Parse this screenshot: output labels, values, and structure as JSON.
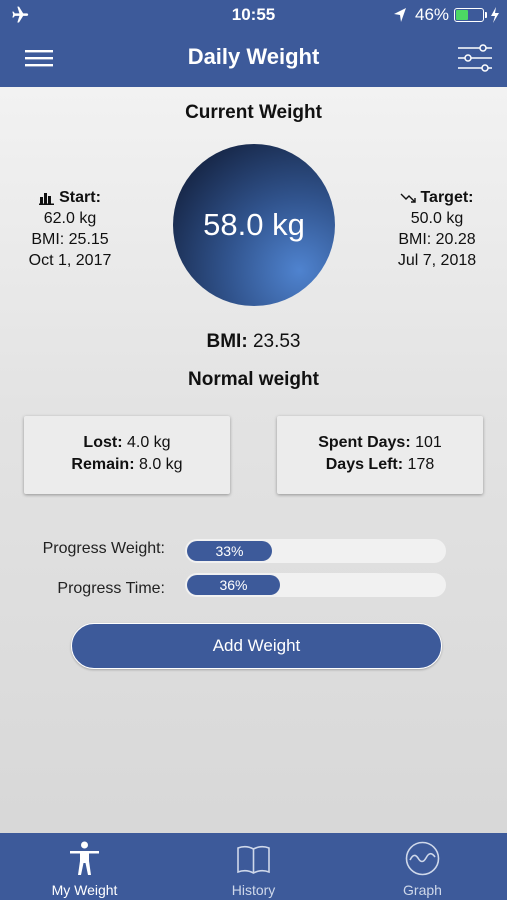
{
  "status_bar": {
    "time": "10:55",
    "battery_percent": "46%",
    "battery_level": 0.46
  },
  "nav": {
    "title": "Daily Weight"
  },
  "current": {
    "title": "Current Weight",
    "weight": "58.0 kg"
  },
  "start": {
    "label": "Start:",
    "weight": "62.0 kg",
    "bmi": "BMI: 25.15",
    "date": "Oct 1, 2017"
  },
  "target": {
    "label": "Target:",
    "weight": "50.0 kg",
    "bmi": "BMI: 20.28",
    "date": "Jul 7, 2018"
  },
  "bmi": {
    "label": "BMI:",
    "value": "23.53",
    "category": "Normal weight"
  },
  "card_weight": {
    "lost_label": "Lost:",
    "lost_value": "4.0 kg",
    "remain_label": "Remain:",
    "remain_value": "8.0 kg"
  },
  "card_days": {
    "spent_label": "Spent Days:",
    "spent_value": "101",
    "left_label": "Days Left:",
    "left_value": "178"
  },
  "progress": {
    "weight_label": "Progress Weight:",
    "weight_text": "33%",
    "weight_fraction": 0.33,
    "time_label": "Progress Time:",
    "time_text": "36%",
    "time_fraction": 0.36
  },
  "add_button": "Add Weight",
  "tabs": [
    {
      "label": "My Weight",
      "icon": "person-icon",
      "active": true
    },
    {
      "label": "History",
      "icon": "book-icon",
      "active": false
    },
    {
      "label": "Graph",
      "icon": "graph-icon",
      "active": false
    }
  ],
  "colors": {
    "primary": "#3d5a9a",
    "battery": "#4cd964"
  }
}
